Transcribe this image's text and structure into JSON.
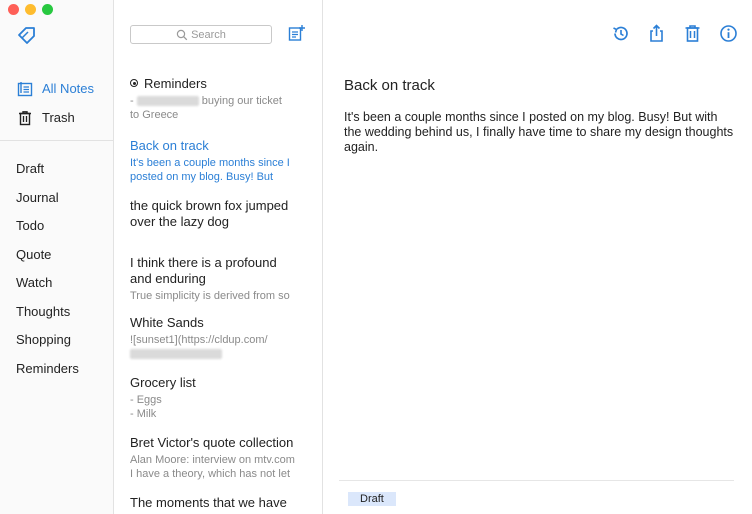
{
  "sidebar": {
    "nav": [
      {
        "label": "All Notes",
        "icon": "notes-icon",
        "active": true
      },
      {
        "label": "Trash",
        "icon": "trash-icon",
        "active": false
      }
    ],
    "tags": [
      "Draft",
      "Journal",
      "Todo",
      "Quote",
      "Watch",
      "Thoughts",
      "Shopping",
      "Reminders"
    ]
  },
  "notes": {
    "search_placeholder": "Search",
    "items": [
      {
        "title": "Reminders",
        "pinned": true,
        "body_suffix": "buying our ticket",
        "body2": "to Greece"
      },
      {
        "title": "Back on track",
        "body": "It's been a couple months since I",
        "body2": "posted on my blog. Busy! But",
        "active": true
      },
      {
        "title": "the quick brown fox jumped",
        "title2": "over the lazy dog"
      },
      {
        "title": "I think there is a profound",
        "title2": "and enduring",
        "body": "True simplicity is derived from so"
      },
      {
        "title": "White Sands",
        "body": "![sunset1](https://cldup.com/"
      },
      {
        "title": "Grocery list",
        "body": "- Eggs",
        "body2": "- Milk"
      },
      {
        "title": "Bret Victor's quote collection",
        "body": "Alan Moore: interview on mtv.com",
        "body2": "I have a theory, which has not let"
      },
      {
        "title": "The moments that we have"
      }
    ]
  },
  "editor": {
    "title": "Back on track",
    "body": "It's been a couple months since I posted on my blog. Busy! But with the wedding behind us, I finally have time to share my design thoughts again.",
    "tag": "Draft"
  },
  "colors": {
    "accent": "#2b7fd6",
    "tag_bg": "#dbe7fb"
  }
}
